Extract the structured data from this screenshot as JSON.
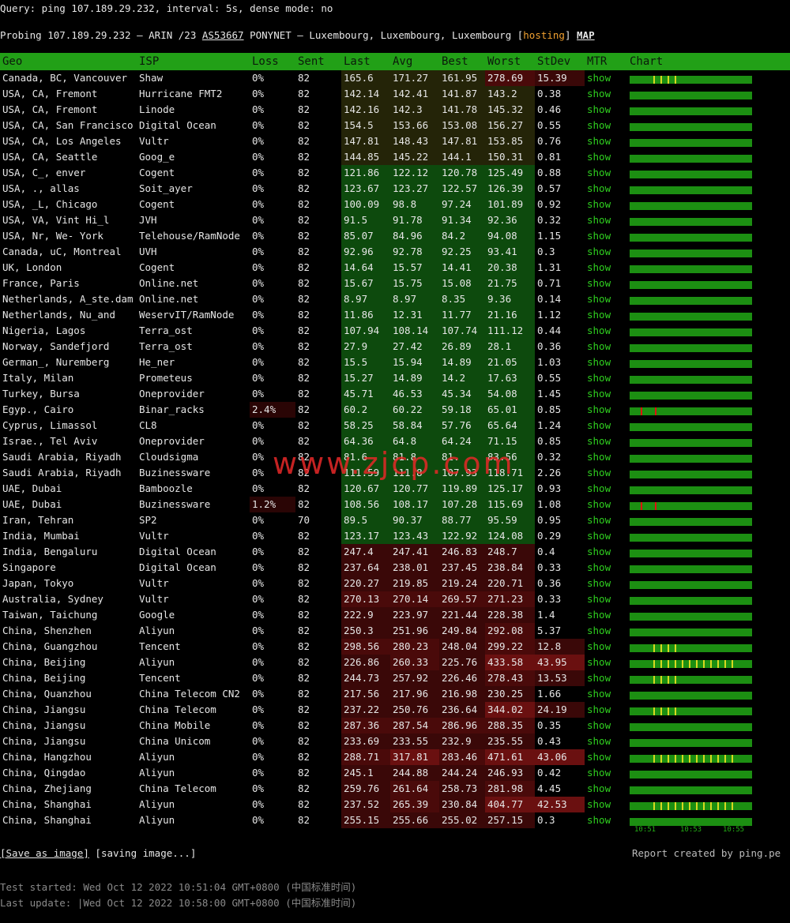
{
  "query_line": "Query: ping 107.189.29.232, interval: 5s, dense mode: no",
  "probe": {
    "prefix": "Probing 107.189.29.232 – ARIN /23 ",
    "asn": "AS53667",
    "mid": " PONYNET – Luxembourg, Luxembourg, Luxembourg [",
    "hosting": "hosting",
    "close": "] ",
    "map": "MAP"
  },
  "headers": [
    "Geo",
    "ISP",
    "Loss",
    "Sent",
    "Last",
    "Avg",
    "Best",
    "Worst",
    "StDev",
    "MTR",
    "Chart"
  ],
  "rows": [
    {
      "geo": "Canada, BC, Vancouver",
      "isp": "Shaw",
      "loss": "0%",
      "sent": "82",
      "last": "165.6",
      "avg": "171.27",
      "best": "161.95",
      "worst": "278.69",
      "stdev": "15.39",
      "mtr": "show"
    },
    {
      "geo": "USA, CA, Fremont",
      "isp": "Hurricane FMT2",
      "loss": "0%",
      "sent": "82",
      "last": "142.14",
      "avg": "142.41",
      "best": "141.87",
      "worst": "143.2",
      "stdev": "0.38",
      "mtr": "show"
    },
    {
      "geo": "USA, CA, Fremont",
      "isp": "Linode",
      "loss": "0%",
      "sent": "82",
      "last": "142.16",
      "avg": "142.3",
      "best": "141.78",
      "worst": "145.32",
      "stdev": "0.46",
      "mtr": "show"
    },
    {
      "geo": "USA, CA, San Francisco",
      "isp": "Digital Ocean",
      "loss": "0%",
      "sent": "82",
      "last": "154.5",
      "avg": "153.66",
      "best": "153.08",
      "worst": "156.27",
      "stdev": "0.55",
      "mtr": "show"
    },
    {
      "geo": "USA, CA, Los Angeles",
      "isp": "Vultr",
      "loss": "0%",
      "sent": "82",
      "last": "147.81",
      "avg": "148.43",
      "best": "147.81",
      "worst": "153.85",
      "stdev": "0.76",
      "mtr": "show"
    },
    {
      "geo": "USA, CA, Seattle",
      "isp": "Goog_e",
      "loss": "0%",
      "sent": "82",
      "last": "144.85",
      "avg": "145.22",
      "best": "144.1",
      "worst": "150.31",
      "stdev": "0.81",
      "mtr": "show"
    },
    {
      "geo": "USA, C_, enver",
      "isp": "Cogent",
      "loss": "0%",
      "sent": "82",
      "last": "121.86",
      "avg": "122.12",
      "best": "120.78",
      "worst": "125.49",
      "stdev": "0.88",
      "mtr": "show"
    },
    {
      "geo": "USA, ., allas",
      "isp": "Soit_ayer",
      "loss": "0%",
      "sent": "82",
      "last": "123.67",
      "avg": "123.27",
      "best": "122.57",
      "worst": "126.39",
      "stdev": "0.57",
      "mtr": "show"
    },
    {
      "geo": "USA, _L, Chicago",
      "isp": "Cogent",
      "loss": "0%",
      "sent": "82",
      "last": "100.09",
      "avg": "98.8",
      "best": "97.24",
      "worst": "101.89",
      "stdev": "0.92",
      "mtr": "show"
    },
    {
      "geo": "USA, VA, Vint Hi_l",
      "isp": "JVH",
      "loss": "0%",
      "sent": "82",
      "last": "91.5",
      "avg": "91.78",
      "best": "91.34",
      "worst": "92.36",
      "stdev": "0.32",
      "mtr": "show"
    },
    {
      "geo": "USA, Nr, We- York",
      "isp": "Telehouse/RamNode",
      "loss": "0%",
      "sent": "82",
      "last": "85.07",
      "avg": "84.96",
      "best": "84.2",
      "worst": "94.08",
      "stdev": "1.15",
      "mtr": "show"
    },
    {
      "geo": "Canada, uC, Montreal",
      "isp": "UVH",
      "loss": "0%",
      "sent": "82",
      "last": "92.96",
      "avg": "92.78",
      "best": "92.25",
      "worst": "93.41",
      "stdev": "0.3",
      "mtr": "show"
    },
    {
      "geo": "UK, London",
      "isp": "Cogent",
      "loss": "0%",
      "sent": "82",
      "last": "14.64",
      "avg": "15.57",
      "best": "14.41",
      "worst": "20.38",
      "stdev": "1.31",
      "mtr": "show"
    },
    {
      "geo": "France, Paris",
      "isp": "Online.net",
      "loss": "0%",
      "sent": "82",
      "last": "15.67",
      "avg": "15.75",
      "best": "15.08",
      "worst": "21.75",
      "stdev": "0.71",
      "mtr": "show"
    },
    {
      "geo": "Netherlands, A_ste.dam",
      "isp": "Online.net",
      "loss": "0%",
      "sent": "82",
      "last": "8.97",
      "avg": "8.97",
      "best": "8.35",
      "worst": "9.36",
      "stdev": "0.14",
      "mtr": "show"
    },
    {
      "geo": "Netherlands, Nu_and",
      "isp": "WeservIT/RamNode",
      "loss": "0%",
      "sent": "82",
      "last": "11.86",
      "avg": "12.31",
      "best": "11.77",
      "worst": "21.16",
      "stdev": "1.12",
      "mtr": "show"
    },
    {
      "geo": "Nigeria, Lagos",
      "isp": "Terra_ost",
      "loss": "0%",
      "sent": "82",
      "last": "107.94",
      "avg": "108.14",
      "best": "107.74",
      "worst": "111.12",
      "stdev": "0.44",
      "mtr": "show"
    },
    {
      "geo": "Norway, Sandefjord",
      "isp": "Terra_ost",
      "loss": "0%",
      "sent": "82",
      "last": "27.9",
      "avg": "27.42",
      "best": "26.89",
      "worst": "28.1",
      "stdev": "0.36",
      "mtr": "show"
    },
    {
      "geo": "German_, Nuremberg",
      "isp": "He_ner",
      "loss": "0%",
      "sent": "82",
      "last": "15.5",
      "avg": "15.94",
      "best": "14.89",
      "worst": "21.05",
      "stdev": "1.03",
      "mtr": "show"
    },
    {
      "geo": "Italy, Milan",
      "isp": "Prometeus",
      "loss": "0%",
      "sent": "82",
      "last": "15.27",
      "avg": "14.89",
      "best": "14.2",
      "worst": "17.63",
      "stdev": "0.55",
      "mtr": "show"
    },
    {
      "geo": "Turkey, Bursa",
      "isp": "Oneprovider",
      "loss": "0%",
      "sent": "82",
      "last": "45.71",
      "avg": "46.53",
      "best": "45.34",
      "worst": "54.08",
      "stdev": "1.45",
      "mtr": "show"
    },
    {
      "geo": "Egyp., Cairo",
      "isp": "Binar_racks",
      "loss": "2.4%",
      "sent": "82",
      "last": "60.2",
      "avg": "60.22",
      "best": "59.18",
      "worst": "65.01",
      "stdev": "0.85",
      "mtr": "show"
    },
    {
      "geo": "Cyprus, Limassol",
      "isp": "CL8",
      "loss": "0%",
      "sent": "82",
      "last": "58.25",
      "avg": "58.84",
      "best": "57.76",
      "worst": "65.64",
      "stdev": "1.24",
      "mtr": "show"
    },
    {
      "geo": "Israe., Tel Aviv",
      "isp": "Oneprovider",
      "loss": "0%",
      "sent": "82",
      "last": "64.36",
      "avg": "64.8",
      "best": "64.24",
      "worst": "71.15",
      "stdev": "0.85",
      "mtr": "show"
    },
    {
      "geo": "Saudi Arabia, Riyadh",
      "isp": "Cloudsigma",
      "loss": "0%",
      "sent": "82",
      "last": "81.6",
      "avg": "81.8",
      "best": "81.",
      "worst": "83.56",
      "stdev": "0.32",
      "mtr": "show"
    },
    {
      "geo": "Saudi Arabia, Riyadh",
      "isp": "Buzinessware",
      "loss": "0%",
      "sent": "82",
      "last": "111.59",
      "avg": "111.8",
      "best": "107.93",
      "worst": "118.71",
      "stdev": "2.26",
      "mtr": "show"
    },
    {
      "geo": "UAE, Dubai",
      "isp": "Bamboozle",
      "loss": "0%",
      "sent": "82",
      "last": "120.67",
      "avg": "120.77",
      "best": "119.89",
      "worst": "125.17",
      "stdev": "0.93",
      "mtr": "show"
    },
    {
      "geo": "UAE, Dubai",
      "isp": "Buzinessware",
      "loss": "1.2%",
      "sent": "82",
      "last": "108.56",
      "avg": "108.17",
      "best": "107.28",
      "worst": "115.69",
      "stdev": "1.08",
      "mtr": "show"
    },
    {
      "geo": "Iran, Tehran",
      "isp": "SP2",
      "loss": "0%",
      "sent": "70",
      "last": "89.5",
      "avg": "90.37",
      "best": "88.77",
      "worst": "95.59",
      "stdev": "0.95",
      "mtr": "show"
    },
    {
      "geo": "India, Mumbai",
      "isp": "Vultr",
      "loss": "0%",
      "sent": "82",
      "last": "123.17",
      "avg": "123.43",
      "best": "122.92",
      "worst": "124.08",
      "stdev": "0.29",
      "mtr": "show"
    },
    {
      "geo": "India, Bengaluru",
      "isp": "Digital Ocean",
      "loss": "0%",
      "sent": "82",
      "last": "247.4",
      "avg": "247.41",
      "best": "246.83",
      "worst": "248.7",
      "stdev": "0.4",
      "mtr": "show"
    },
    {
      "geo": "Singapore",
      "isp": "Digital Ocean",
      "loss": "0%",
      "sent": "82",
      "last": "237.64",
      "avg": "238.01",
      "best": "237.45",
      "worst": "238.84",
      "stdev": "0.33",
      "mtr": "show"
    },
    {
      "geo": "Japan, Tokyo",
      "isp": "Vultr",
      "loss": "0%",
      "sent": "82",
      "last": "220.27",
      "avg": "219.85",
      "best": "219.24",
      "worst": "220.71",
      "stdev": "0.36",
      "mtr": "show"
    },
    {
      "geo": "Australia, Sydney",
      "isp": "Vultr",
      "loss": "0%",
      "sent": "82",
      "last": "270.13",
      "avg": "270.14",
      "best": "269.57",
      "worst": "271.23",
      "stdev": "0.33",
      "mtr": "show"
    },
    {
      "geo": "Taiwan, Taichung",
      "isp": "Google",
      "loss": "0%",
      "sent": "82",
      "last": "222.9",
      "avg": "223.97",
      "best": "221.44",
      "worst": "228.38",
      "stdev": "1.4",
      "mtr": "show"
    },
    {
      "geo": "China, Shenzhen",
      "isp": "Aliyun",
      "loss": "0%",
      "sent": "82",
      "last": "250.3",
      "avg": "251.96",
      "best": "249.84",
      "worst": "292.08",
      "stdev": "5.37",
      "mtr": "show"
    },
    {
      "geo": "China, Guangzhou",
      "isp": "Tencent",
      "loss": "0%",
      "sent": "82",
      "last": "298.56",
      "avg": "280.23",
      "best": "248.04",
      "worst": "299.22",
      "stdev": "12.8",
      "mtr": "show"
    },
    {
      "geo": "China, Beijing",
      "isp": "Aliyun",
      "loss": "0%",
      "sent": "82",
      "last": "226.86",
      "avg": "260.33",
      "best": "225.76",
      "worst": "433.58",
      "stdev": "43.95",
      "mtr": "show"
    },
    {
      "geo": "China, Beijing",
      "isp": "Tencent",
      "loss": "0%",
      "sent": "82",
      "last": "244.73",
      "avg": "257.92",
      "best": "226.46",
      "worst": "278.43",
      "stdev": "13.53",
      "mtr": "show"
    },
    {
      "geo": "China, Quanzhou",
      "isp": "China Telecom CN2",
      "loss": "0%",
      "sent": "82",
      "last": "217.56",
      "avg": "217.96",
      "best": "216.98",
      "worst": "230.25",
      "stdev": "1.66",
      "mtr": "show"
    },
    {
      "geo": "China, Jiangsu",
      "isp": "China Telecom",
      "loss": "0%",
      "sent": "82",
      "last": "237.22",
      "avg": "250.76",
      "best": "236.64",
      "worst": "344.02",
      "stdev": "24.19",
      "mtr": "show"
    },
    {
      "geo": "China, Jiangsu",
      "isp": "China Mobile",
      "loss": "0%",
      "sent": "82",
      "last": "287.36",
      "avg": "287.54",
      "best": "286.96",
      "worst": "288.35",
      "stdev": "0.35",
      "mtr": "show"
    },
    {
      "geo": "China, Jiangsu",
      "isp": "China Unicom",
      "loss": "0%",
      "sent": "82",
      "last": "233.69",
      "avg": "233.55",
      "best": "232.9",
      "worst": "235.55",
      "stdev": "0.43",
      "mtr": "show"
    },
    {
      "geo": "China, Hangzhou",
      "isp": "Aliyun",
      "loss": "0%",
      "sent": "82",
      "last": "288.71",
      "avg": "317.81",
      "best": "283.46",
      "worst": "471.61",
      "stdev": "43.06",
      "mtr": "show"
    },
    {
      "geo": "China, Qingdao",
      "isp": "Aliyun",
      "loss": "0%",
      "sent": "82",
      "last": "245.1",
      "avg": "244.88",
      "best": "244.24",
      "worst": "246.93",
      "stdev": "0.42",
      "mtr": "show"
    },
    {
      "geo": "China, Zhejiang",
      "isp": "China Telecom",
      "loss": "0%",
      "sent": "82",
      "last": "259.76",
      "avg": "261.64",
      "best": "258.73",
      "worst": "281.98",
      "stdev": "4.45",
      "mtr": "show"
    },
    {
      "geo": "China, Shanghai",
      "isp": "Aliyun",
      "loss": "0%",
      "sent": "82",
      "last": "237.52",
      "avg": "265.39",
      "best": "230.84",
      "worst": "404.77",
      "stdev": "42.53",
      "mtr": "show"
    },
    {
      "geo": "China, Shanghai",
      "isp": "Aliyun",
      "loss": "0%",
      "sent": "82",
      "last": "255.15",
      "avg": "255.66",
      "best": "255.02",
      "worst": "257.15",
      "stdev": "0.3",
      "mtr": "show"
    }
  ],
  "chart_axis": [
    "10:51",
    "10:53",
    "10:55"
  ],
  "footer": {
    "save": "[Save as image]",
    "saving": " [saving image...]",
    "report": "Report created by ping.pe",
    "started": "Test started: Wed Oct 12 2022 10:51:04 GMT+0800 (中国标准时间)",
    "updated": "Last update: |Wed Oct 12 2022 10:58:00 GMT+0800 (中国标准时间)"
  },
  "watermark": "www.zjcp.com",
  "colors": {
    "header_bg": "#22a017",
    "ok_green": "#0e4d0e",
    "warn_red": "#4a0a0a",
    "show_link": "#2fd01f"
  }
}
